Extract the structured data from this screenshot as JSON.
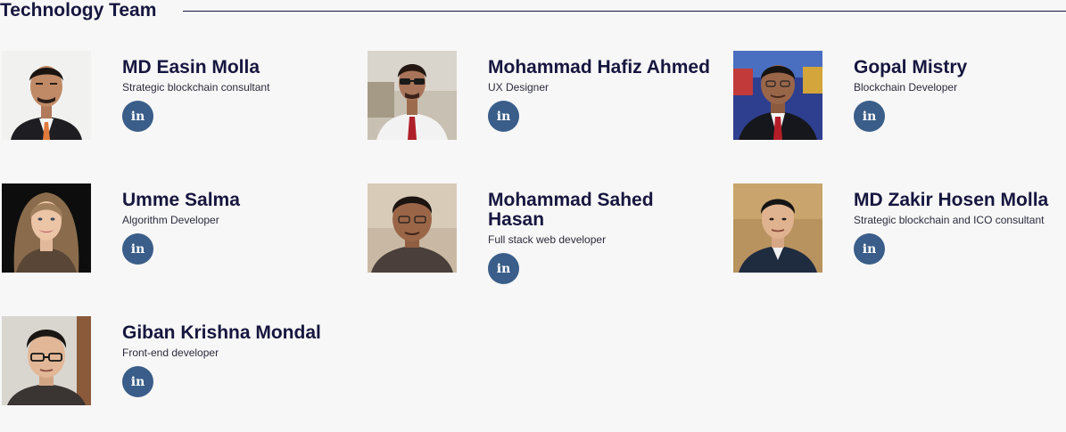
{
  "section": {
    "title": "Technology Team"
  },
  "members": [
    {
      "name": "MD Easin Molla",
      "role": "Strategic blockchain consultant",
      "social_label": "in",
      "photo_icon": "person-photo"
    },
    {
      "name": "Mohammad Hafiz Ahmed",
      "role": "UX Designer",
      "social_label": "in",
      "photo_icon": "person-photo"
    },
    {
      "name": "Gopal Mistry",
      "role": "Blockchain Developer",
      "social_label": "in",
      "photo_icon": "person-photo"
    },
    {
      "name": "Umme Salma",
      "role": "Algorithm Developer",
      "social_label": "in",
      "photo_icon": "person-photo"
    },
    {
      "name": "Mohammad Sahed Hasan",
      "role": "Full stack web developer",
      "social_label": "in",
      "photo_icon": "person-photo"
    },
    {
      "name": "MD Zakir Hosen Molla",
      "role": "Strategic blockchain and ICO consultant",
      "social_label": "in",
      "photo_icon": "person-photo"
    },
    {
      "name": "Giban Krishna Mondal",
      "role": "Front-end developer",
      "social_label": "in",
      "photo_icon": "person-photo"
    }
  ],
  "colors": {
    "heading": "#16163f",
    "linkedin_badge": "#3a5d89",
    "background": "#f7f7f7"
  }
}
